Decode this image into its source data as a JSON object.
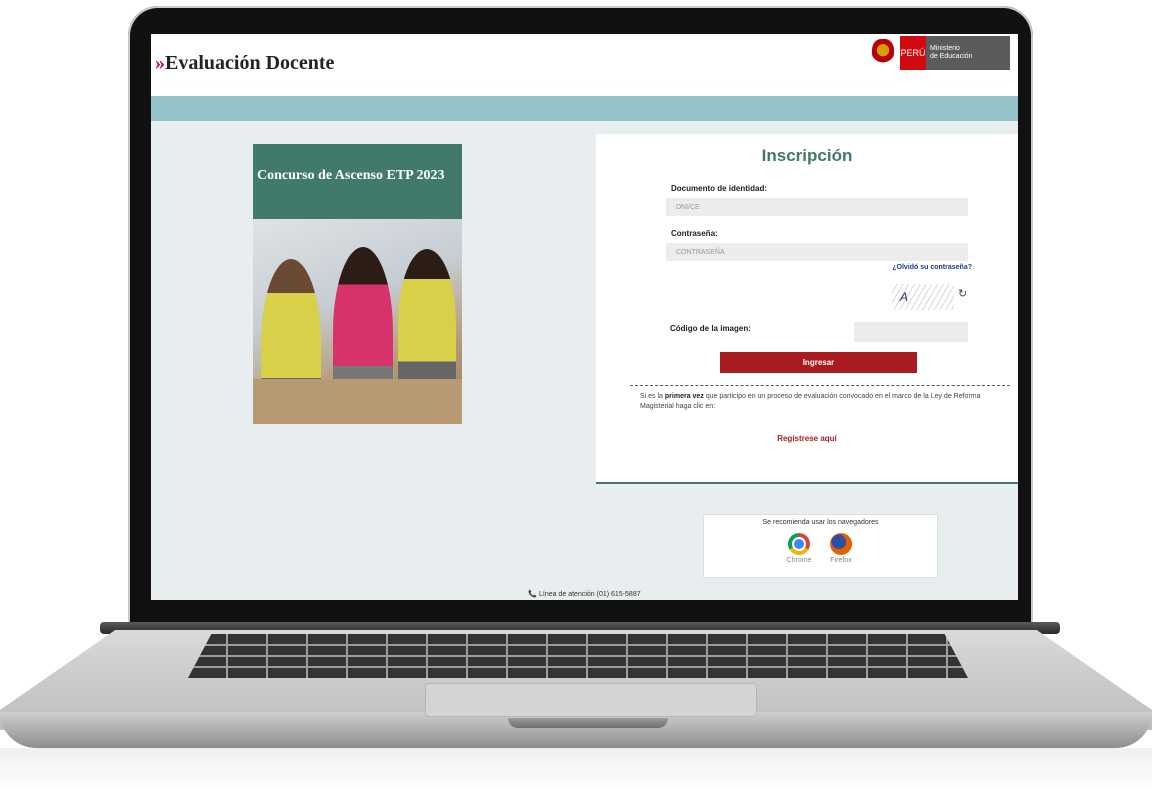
{
  "header": {
    "brand_chevron": "»",
    "brand_title": "Evaluación Docente",
    "peru_label": "PERÚ",
    "ministry_line1": "Ministerio",
    "ministry_line2": "de Educación"
  },
  "poster": {
    "title": "Concurso de Ascenso ETP 2023"
  },
  "form": {
    "title": "Inscripción",
    "doc_label": "Documento de identidad:",
    "doc_placeholder": "DNI/CE",
    "password_label": "Contraseña:",
    "password_placeholder": "CONTRASEÑA",
    "forgot_link": "¿Olvidó su contraseña?",
    "captcha_text": "A",
    "captcha_label": "Código de la imagen:",
    "submit_label": "Ingresar",
    "first_time_pre": "Si es la ",
    "first_time_bold": "primera vez",
    "first_time_post": " que participo en un proceso de evaluación convocado en el marco de la Ley de Reforma Magisterial haga clic en:",
    "register_link": "Regístrese aquí"
  },
  "browsers": {
    "title": "Se recomienda usar los navegadores",
    "chrome": "Chrome",
    "firefox": "Firefox"
  },
  "footer": {
    "phone_text": "Línea de atención (01) 615-5887"
  }
}
